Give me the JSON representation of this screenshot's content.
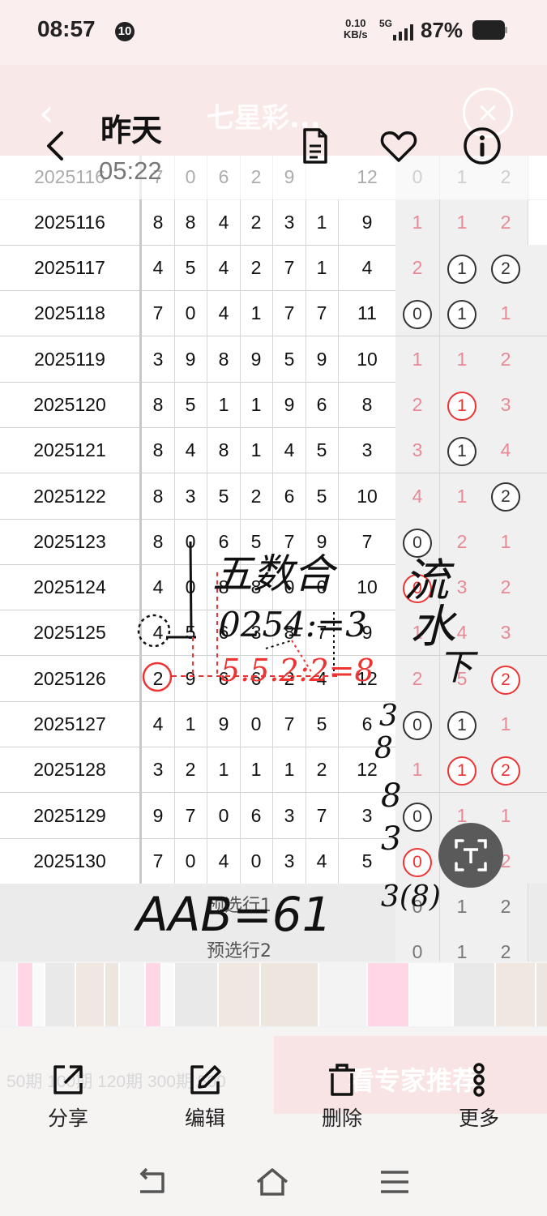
{
  "status_bar": {
    "time": "08:57",
    "notif_count": "10",
    "speed_value": "0.10",
    "speed_unit": "KB/s",
    "network": "5G",
    "battery": "87%"
  },
  "app_header_faded": {
    "title": "七星彩..."
  },
  "viewer": {
    "date_label": "昨天",
    "time_label": "05:22",
    "icons": [
      "back-icon",
      "document-icon",
      "heart-icon",
      "info-icon"
    ]
  },
  "table": {
    "partial_top_row": [
      "2025116",
      "7",
      "0",
      "6",
      "2",
      "9",
      "12",
      "0",
      "1",
      "2"
    ],
    "partial_row2": [
      "2025116",
      "8",
      "8",
      "4",
      "2",
      "3",
      "1",
      "9",
      "1",
      "1",
      "2"
    ],
    "rows": [
      {
        "issue": "2025117",
        "digits": [
          "4",
          "5",
          "4",
          "2",
          "7",
          "1"
        ],
        "sum": "4",
        "z": [
          {
            "v": "2",
            "s": "pink"
          },
          {
            "v": "1",
            "s": "ring"
          },
          {
            "v": "2",
            "s": "ring"
          }
        ]
      },
      {
        "issue": "2025118",
        "digits": [
          "7",
          "0",
          "4",
          "1",
          "7",
          "7"
        ],
        "sum": "11",
        "z": [
          {
            "v": "0",
            "s": "ring"
          },
          {
            "v": "1",
            "s": "ring"
          },
          {
            "v": "1",
            "s": "pink"
          }
        ]
      },
      {
        "issue": "2025119",
        "digits": [
          "3",
          "9",
          "8",
          "9",
          "5",
          "9"
        ],
        "sum": "10",
        "z": [
          {
            "v": "1",
            "s": "pink"
          },
          {
            "v": "1",
            "s": "pink"
          },
          {
            "v": "2",
            "s": "pink"
          }
        ]
      },
      {
        "issue": "2025120",
        "digits": [
          "8",
          "5",
          "1",
          "1",
          "9",
          "6"
        ],
        "sum": "8",
        "z": [
          {
            "v": "2",
            "s": "pink"
          },
          {
            "v": "1",
            "s": "ringred"
          },
          {
            "v": "3",
            "s": "pink"
          }
        ]
      },
      {
        "issue": "2025121",
        "digits": [
          "8",
          "4",
          "8",
          "1",
          "4",
          "5"
        ],
        "sum": "3",
        "z": [
          {
            "v": "3",
            "s": "pink"
          },
          {
            "v": "1",
            "s": "ring"
          },
          {
            "v": "4",
            "s": "pink"
          }
        ]
      },
      {
        "issue": "2025122",
        "digits": [
          "8",
          "3",
          "5",
          "2",
          "6",
          "5"
        ],
        "sum": "10",
        "z": [
          {
            "v": "4",
            "s": "pink"
          },
          {
            "v": "1",
            "s": "pink"
          },
          {
            "v": "2",
            "s": "ring"
          }
        ]
      },
      {
        "issue": "2025123",
        "digits": [
          "8",
          "0",
          "6",
          "5",
          "7",
          "9"
        ],
        "sum": "7",
        "z": [
          {
            "v": "0",
            "s": "ring"
          },
          {
            "v": "2",
            "s": "pink"
          },
          {
            "v": "1",
            "s": "pink"
          }
        ]
      },
      {
        "issue": "2025124",
        "digits": [
          "4",
          "0",
          "8",
          "8",
          "0",
          "0"
        ],
        "sum": "10",
        "z": [
          {
            "v": "0",
            "s": "ringred"
          },
          {
            "v": "3",
            "s": "pink"
          },
          {
            "v": "2",
            "s": "pink"
          }
        ]
      },
      {
        "issue": "2025125",
        "digits": [
          "4",
          "5",
          "6",
          "3",
          "8",
          "7"
        ],
        "sum": "9",
        "z": [
          {
            "v": "1",
            "s": "pink"
          },
          {
            "v": "4",
            "s": "pink"
          },
          {
            "v": "3",
            "s": "pink"
          }
        ]
      },
      {
        "issue": "2025126",
        "digits": [
          "2",
          "9",
          "6",
          "6",
          "2",
          "4"
        ],
        "sum": "12",
        "z": [
          {
            "v": "2",
            "s": "pink"
          },
          {
            "v": "5",
            "s": "pink"
          },
          {
            "v": "2",
            "s": "ringred"
          }
        ]
      },
      {
        "issue": "2025127",
        "digits": [
          "4",
          "1",
          "9",
          "0",
          "7",
          "5"
        ],
        "sum": "6",
        "z": [
          {
            "v": "0",
            "s": "ring"
          },
          {
            "v": "1",
            "s": "ring"
          },
          {
            "v": "1",
            "s": "pink"
          }
        ]
      },
      {
        "issue": "2025128",
        "digits": [
          "3",
          "2",
          "1",
          "1",
          "1",
          "2"
        ],
        "sum": "12",
        "z": [
          {
            "v": "1",
            "s": "pink"
          },
          {
            "v": "1",
            "s": "ringred"
          },
          {
            "v": "2",
            "s": "ringred"
          }
        ]
      },
      {
        "issue": "2025129",
        "digits": [
          "9",
          "7",
          "0",
          "6",
          "3",
          "7"
        ],
        "sum": "3",
        "z": [
          {
            "v": "0",
            "s": "ring"
          },
          {
            "v": "1",
            "s": "pink"
          },
          {
            "v": "1",
            "s": "pink"
          }
        ]
      },
      {
        "issue": "2025130",
        "digits": [
          "7",
          "0",
          "4",
          "0",
          "3",
          "4"
        ],
        "sum": "5",
        "z": [
          {
            "v": "0",
            "s": "ringred"
          },
          {
            "v": "1",
            "s": "pink"
          },
          {
            "v": "2",
            "s": "pink"
          }
        ]
      }
    ],
    "preselect_rows": [
      {
        "label": "预选行1",
        "z": [
          "0",
          "1",
          "2"
        ]
      },
      {
        "label": "预选行2",
        "z": [
          "0",
          "1",
          "2"
        ]
      }
    ]
  },
  "handwriting": {
    "line1": "五数合",
    "line2": "0254:=3",
    "line3": "5.5.2:2=8",
    "side1": "流",
    "side2": "水",
    "side3": "下",
    "column": [
      "3",
      "8",
      "8",
      "3",
      "3(8)"
    ],
    "bottom": "AAB=61"
  },
  "bottom_bar": {
    "faded_left": "50期 100期 120期 300期 500",
    "faded_right": "看专家推荐",
    "actions": [
      {
        "label": "分享",
        "icon": "share-icon"
      },
      {
        "label": "编辑",
        "icon": "edit-icon"
      },
      {
        "label": "删除",
        "icon": "delete-icon"
      },
      {
        "label": "更多",
        "icon": "more-icon"
      }
    ]
  },
  "nav_bar": {
    "icons": [
      "nav-back-icon",
      "nav-home-icon",
      "nav-menu-icon"
    ]
  }
}
